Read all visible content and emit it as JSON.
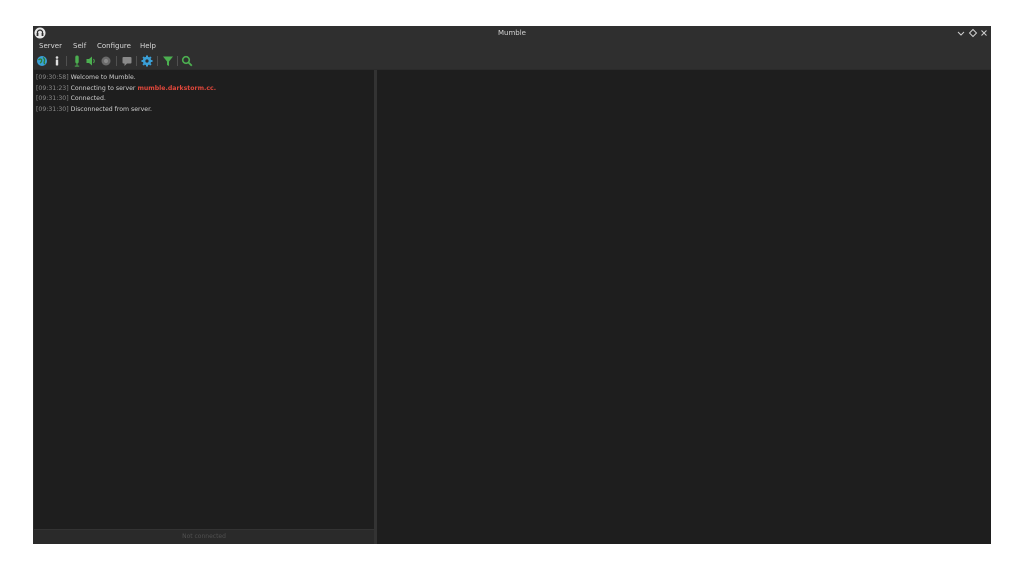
{
  "window": {
    "title": "Mumble"
  },
  "menubar": {
    "items": [
      {
        "label": "Server"
      },
      {
        "label": "Self"
      },
      {
        "label": "Configure"
      },
      {
        "label": "Help"
      }
    ]
  },
  "toolbar": {
    "icons": [
      "globe-connect-icon",
      "info-icon",
      "microphone-icon",
      "speaker-icon",
      "record-icon",
      "comment-icon",
      "settings-gear-icon",
      "filter-icon",
      "search-icon"
    ],
    "accent_green": "#4caf50",
    "accent_blue": "#2196f3"
  },
  "log": {
    "lines": [
      {
        "time": "[09:30:58]",
        "text": " Welcome to Mumble."
      },
      {
        "time": "[09:31:23]",
        "text": " Connecting to server ",
        "host": "mumble.darkstorm.cc",
        "suffix": "."
      },
      {
        "time": "[09:31:30]",
        "text": " Connected."
      },
      {
        "time": "[09:31:30]",
        "text": " Disconnected from server."
      }
    ]
  },
  "status": {
    "text": "Not connected"
  },
  "colors": {
    "window_bg": "#2b2b2b",
    "pane_bg": "#1e1e1e",
    "host_link": "#e0473b"
  }
}
